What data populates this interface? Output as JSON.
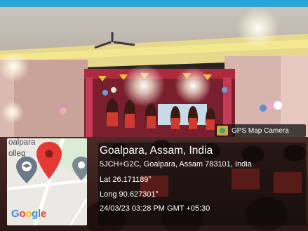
{
  "camera_badge": {
    "label": "GPS Map Camera",
    "icon": "gps-map-camera-icon"
  },
  "map": {
    "label_line1": "oalpara",
    "label_line2": "olleg",
    "logo_text": "Google",
    "icons": [
      "location-pin-icon",
      "school-pin-icon",
      "location-pin-gray-icon"
    ]
  },
  "location": {
    "place": "Goalpara, Assam, India",
    "address": "5JCH+G2C, Goalpara, Assam 783101, India",
    "lat": "Lat 26.171189°",
    "long": "Long 90.627301°",
    "datetime": "24/03/23 03:28 PM GMT +05:30"
  },
  "colors": {
    "frame_border": "#2aa3d6",
    "pin_red": "#e53935"
  }
}
